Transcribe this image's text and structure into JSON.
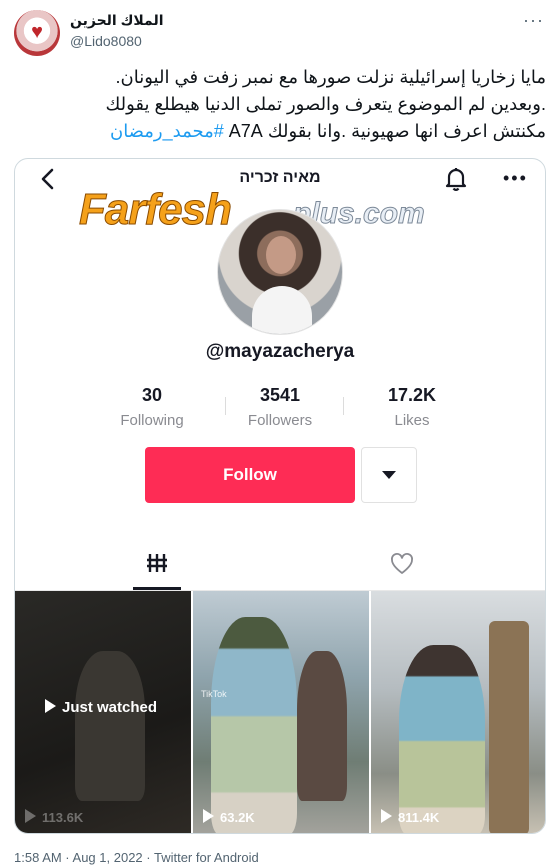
{
  "tweet": {
    "display_name": "الملاك الحزين",
    "handle": "@Lido8080",
    "text_lines": [
      "مايا زخاريا إسرائيلية نزلت صورها مع نمبر زفت في اليونان.",
      ".وبعدين لم الموضوع يتعرف والصور تملى الدنيا هيطلع يقولك",
      "مكنتش اعرف انها صهيونية .وانا بقولك A7A"
    ],
    "hashtag": "#محمد_رمضان",
    "meta": "1:58 AM · Aug 1, 2022 · Twitter for Android"
  },
  "media": {
    "watermark_main": "Farfesh",
    "watermark_sub": "plus.com",
    "profile_title": "מאיה זכריה",
    "username": "@mayazacherya",
    "stats": [
      {
        "value": "30",
        "label": "Following"
      },
      {
        "value": "3541",
        "label": "Followers"
      },
      {
        "value": "17.2K",
        "label": "Likes"
      }
    ],
    "follow_label": "Follow",
    "thumbs": [
      {
        "overlay": "Just watched",
        "views": "113.6K"
      },
      {
        "views": "63.2K",
        "tiktok_tag": "TikTok"
      },
      {
        "views": "811.4K"
      }
    ]
  },
  "icons": {
    "back": "chevron-left-icon",
    "bell": "bell-icon",
    "more": "more-dots-icon",
    "grid": "video-grid-icon",
    "liked": "heart-outline-icon"
  },
  "colors": {
    "follow": "#fe2c55",
    "hashtag": "#1d9bf0",
    "watermark": "#f5a11a"
  }
}
